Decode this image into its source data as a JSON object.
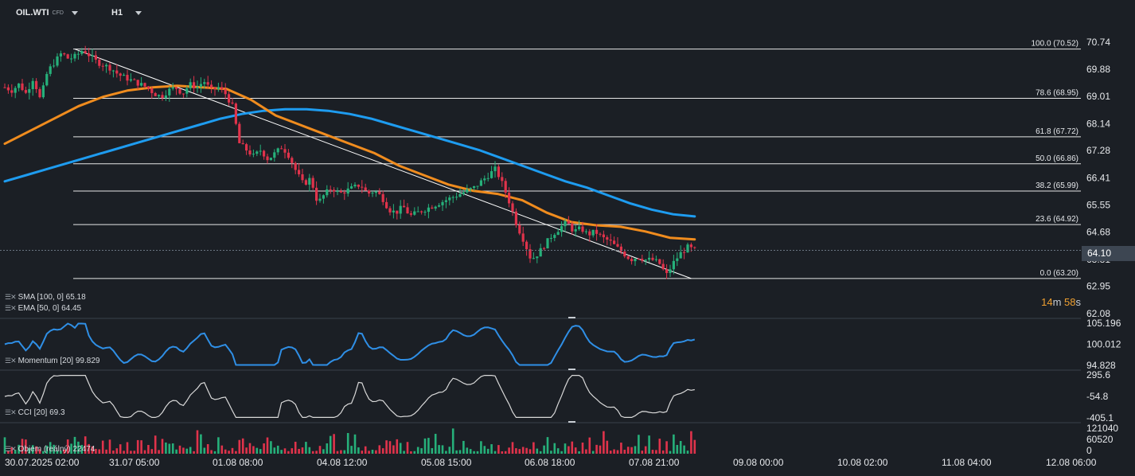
{
  "header": {
    "symbol": "OIL.WTI",
    "symbol_sub": "CFD",
    "timeframe": "H1"
  },
  "current_price": "64.10",
  "countdown": {
    "minutes": "14",
    "m": "m",
    "seconds": "58",
    "s": "s"
  },
  "legends": {
    "sma": "SMA [100,  0]  65.18",
    "ema": "EMA [50,  0]  64.45",
    "momentum": "Momentum  [20]  99.829",
    "cci": "CCI [20]  69.3",
    "volume": "Objem (reálný)  22474"
  },
  "colors": {
    "background": "#1b1f25",
    "up": "#26b07a",
    "down": "#e0334b",
    "sma": "#1e9cf0",
    "ema": "#f08c1e",
    "momentum": "#2f8fe6",
    "cci": "#d9d9d9",
    "fib": "#e6e6e6"
  },
  "chart_data": {
    "type": "candlestick",
    "price_axis": {
      "ticks": [
        "70.74",
        "69.88",
        "69.01",
        "68.14",
        "67.28",
        "66.41",
        "65.55",
        "64.68",
        "63.81",
        "62.95",
        "62.08"
      ],
      "range": [
        62.08,
        70.74
      ]
    },
    "time_axis": {
      "ticks": [
        "30.07.2025  02:00",
        "31.07  05:00",
        "01.08  08:00",
        "04.08  12:00",
        "05.08  15:00",
        "06.08  18:00",
        "07.08  21:00",
        "09.08  00:00",
        "10.08  02:00",
        "11.08  04:00",
        "12.08  06:00"
      ]
    },
    "fibonacci": [
      {
        "label": "100.0 (70.52)",
        "price": 70.52
      },
      {
        "label": "78.6 (68.95)",
        "price": 68.95
      },
      {
        "label": "61.8 (67.72)",
        "price": 67.72
      },
      {
        "label": "50.0 (66.86)",
        "price": 66.86
      },
      {
        "label": "38.2 (65.99)",
        "price": 65.99
      },
      {
        "label": "23.6 (64.92)",
        "price": 64.92
      },
      {
        "label": "0.0 (63.20)",
        "price": 63.2
      }
    ],
    "trendline": {
      "from_index": 20,
      "from_price": 70.52,
      "to_index": 196,
      "to_price": 63.2
    },
    "close_series": [
      69.3,
      69.2,
      69.4,
      69.1,
      69.6,
      68.9,
      69.8,
      70.1,
      70.4,
      70.2,
      70.3,
      70.5,
      70.3,
      70.1,
      70.0,
      69.9,
      69.7,
      69.6,
      69.5,
      69.4,
      69.3,
      69.1,
      69.0,
      69.2,
      69.3,
      69.1,
      69.4,
      69.3,
      69.5,
      69.2,
      69.3,
      69.1,
      68.7,
      67.5,
      67.3,
      67.1,
      67.3,
      67.0,
      67.2,
      67.4,
      67.1,
      66.6,
      66.2,
      66.4,
      65.6,
      65.9,
      66.1,
      65.9,
      66.0,
      66.1,
      66.2,
      65.9,
      66.0,
      65.8,
      65.4,
      65.3,
      65.5,
      65.2,
      65.3,
      65.4,
      65.5,
      65.6,
      65.7,
      65.8,
      65.9,
      66.0,
      66.1,
      66.3,
      66.5,
      66.7,
      66.2,
      65.6,
      64.9,
      64.4,
      63.8,
      64.0,
      64.3,
      64.6,
      64.8,
      65.0,
      64.7,
      64.8,
      64.6,
      64.7,
      64.5,
      64.4,
      64.2,
      64.0,
      63.8,
      63.9,
      63.8,
      63.8,
      63.7,
      63.3,
      63.7,
      64.0,
      64.2,
      64.1
    ],
    "sma_100": [
      66.3,
      66.5,
      66.7,
      66.9,
      67.1,
      67.3,
      67.5,
      67.7,
      67.9,
      68.1,
      68.3,
      68.45,
      68.55,
      68.6,
      68.6,
      68.55,
      68.45,
      68.3,
      68.1,
      67.9,
      67.7,
      67.5,
      67.3,
      67.05,
      66.8,
      66.55,
      66.3,
      66.1,
      65.85,
      65.6,
      65.4,
      65.25,
      65.18
    ],
    "ema_50": [
      67.5,
      67.9,
      68.3,
      68.7,
      69.0,
      69.2,
      69.3,
      69.35,
      69.3,
      69.25,
      68.9,
      68.4,
      68.1,
      67.8,
      67.5,
      67.2,
      66.8,
      66.5,
      66.2,
      66.0,
      65.9,
      65.7,
      65.3,
      65.0,
      64.9,
      64.85,
      64.7,
      64.5,
      64.45
    ],
    "momentum": {
      "ticks": [
        "105.196",
        "100.012",
        "94.828"
      ],
      "last": 99.829
    },
    "cci": {
      "ticks": [
        "295.6",
        "-54.8",
        "-405.1"
      ],
      "last": 69.3
    },
    "volume": {
      "ticks": [
        "121040",
        "60520",
        "0"
      ],
      "last": 22474
    }
  }
}
